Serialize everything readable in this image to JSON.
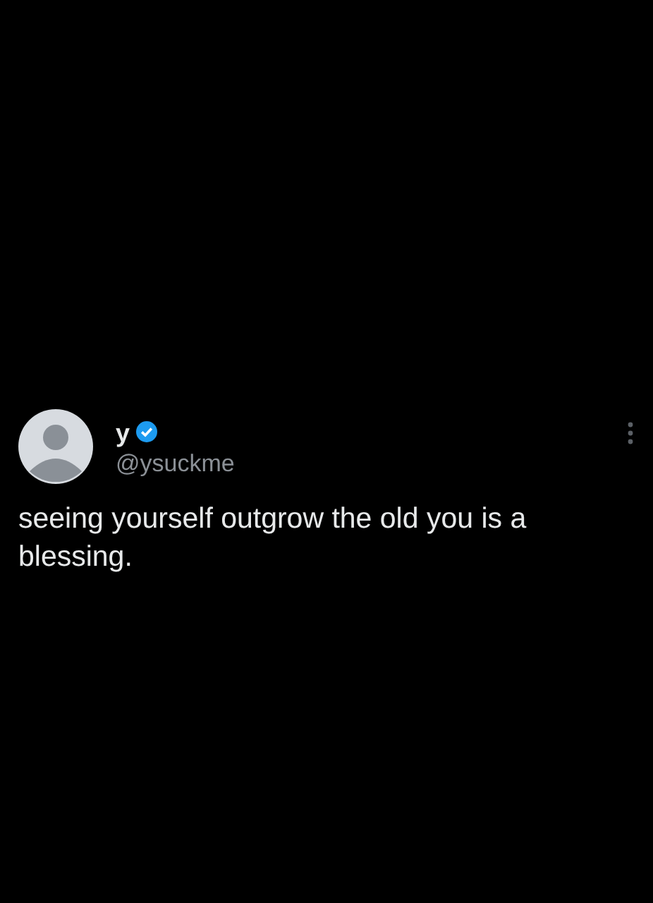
{
  "tweet": {
    "display_name": "y",
    "verified": true,
    "handle": "@ysuckme",
    "text": "seeing yourself outgrow the old you is a blessing."
  }
}
